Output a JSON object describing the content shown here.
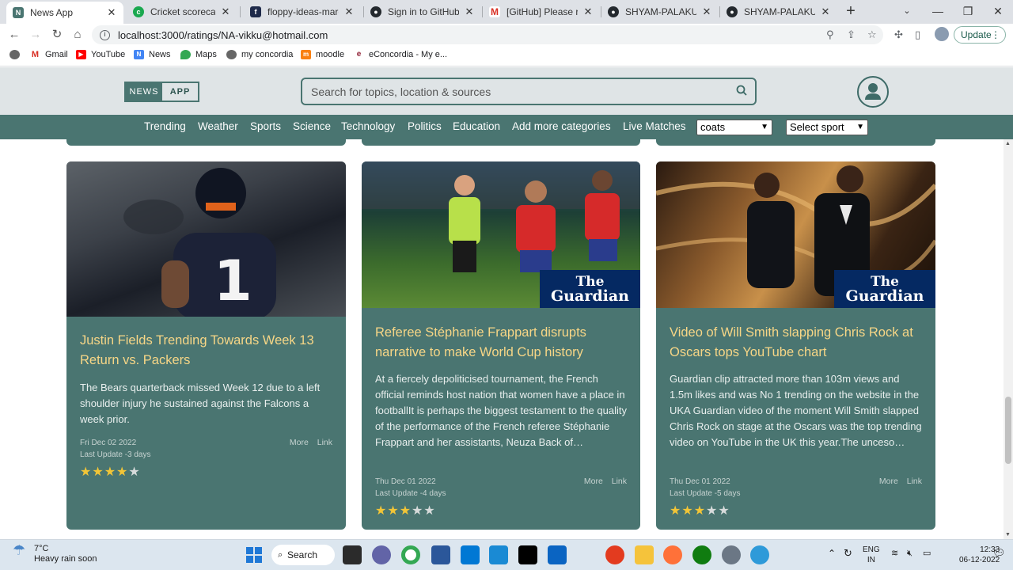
{
  "browser": {
    "tabs": [
      {
        "title": "News App",
        "active": true,
        "icon": "news-app-favicon",
        "color": "#4a7571"
      },
      {
        "title": "Cricket scorecard - Ba",
        "active": false,
        "icon": "cricbuzz-favicon",
        "color": "#1aa84f"
      },
      {
        "title": "floppy-ideas-march-...",
        "active": false,
        "icon": "floppy-favicon",
        "color": "#1e2a4a"
      },
      {
        "title": "Sign in to GitHub · Gi",
        "active": false,
        "icon": "github-favicon",
        "color": "#24292e"
      },
      {
        "title": "[GitHub] Please reset",
        "active": false,
        "icon": "gmail-favicon",
        "color": "#d93025"
      },
      {
        "title": "SHYAM-PALAKURTHI",
        "active": false,
        "icon": "github-favicon",
        "color": "#24292e"
      },
      {
        "title": "SHYAM-PALAKURTHI",
        "active": false,
        "icon": "github-favicon",
        "color": "#24292e"
      }
    ],
    "url": "localhost:3000/ratings/NA-vikku@hotmail.com",
    "update_label": "Update",
    "bookmarks": [
      {
        "label": "",
        "icon": "apps-icon"
      },
      {
        "label": "Gmail",
        "icon": "gmail-icon"
      },
      {
        "label": "YouTube",
        "icon": "youtube-icon"
      },
      {
        "label": "News",
        "icon": "google-news-icon"
      },
      {
        "label": "Maps",
        "icon": "maps-icon"
      },
      {
        "label": "my concordia",
        "icon": "globe-icon"
      },
      {
        "label": "moodle",
        "icon": "moodle-icon"
      },
      {
        "label": "eConcordia - My e...",
        "icon": "econcordia-icon"
      }
    ]
  },
  "app": {
    "logo": {
      "left": "NEWS",
      "right": "APP"
    },
    "search_placeholder": "Search for topics, location & sources",
    "categories": [
      "Trending",
      "Weather",
      "Sports",
      "Science",
      "Technology",
      "Politics",
      "Education",
      "Add more categories",
      "Live Matches"
    ],
    "select_country": "coats",
    "select_sport": "Select sport"
  },
  "articles": [
    {
      "title": "Justin Fields Trending Towards Week 13 Return vs. Packers",
      "description": "The Bears quarterback missed Week 12 due to a left shoulder injury he sustained against the Falcons a week prior.",
      "date": "Fri Dec 02 2022",
      "last_update": "Last Update -3 days",
      "more_label": "More",
      "link_label": "Link",
      "rating": 4,
      "source_logo": ""
    },
    {
      "title": "Referee Stéphanie Frappart disrupts narrative to make World Cup history",
      "description": "At a fiercely depoliticised tournament, the French official reminds host nation that women have a place in footballIt is perhaps the biggest testament to the quality of the performance of the French referee Stéphanie Frappart and her assistants, Neuza Back of…",
      "date": "Thu Dec 01 2022",
      "last_update": "Last Update -4 days",
      "more_label": "More",
      "link_label": "Link",
      "rating": 3,
      "source_logo": {
        "line1": "The",
        "line2": "Guardian"
      }
    },
    {
      "title": "Video of Will Smith slapping Chris Rock at Oscars tops YouTube chart",
      "description": "Guardian clip attracted more than 103m views and 1.5m likes and was No 1 trending on the website in the UKA Guardian video of the moment Will Smith slapped Chris Rock on stage at the Oscars was the top trending video on YouTube in the UK this year.The unceso…",
      "date": "Thu Dec 01 2022",
      "last_update": "Last Update -5 days",
      "more_label": "More",
      "link_label": "Link",
      "rating": 3,
      "source_logo": {
        "line1": "The",
        "line2": "Guardian"
      }
    }
  ],
  "taskbar": {
    "weather_temp": "7°C",
    "weather_cond": "Heavy rain soon",
    "search_label": "Search",
    "lang": "ENG",
    "region": "IN",
    "time": "12:33",
    "date": "06-12-2022"
  }
}
